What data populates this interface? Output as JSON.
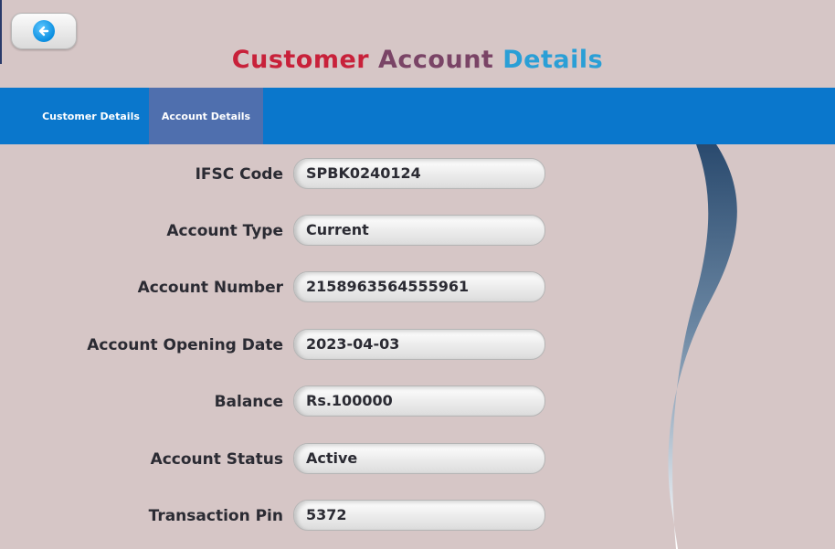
{
  "header": {
    "back_button_icon": "back-arrow-icon",
    "title_word1": "Customer",
    "title_word2": "Account",
    "title_word3": "Details",
    "title_colors": [
      "#c8213a",
      "#7a4466",
      "#2a9fd6"
    ]
  },
  "tabs": [
    {
      "label": "Customer Details",
      "active": false
    },
    {
      "label": "Account Details",
      "active": true
    }
  ],
  "fields": [
    {
      "label": "IFSC Code",
      "value": "SPBK0240124"
    },
    {
      "label": "Account Type",
      "value": "Current"
    },
    {
      "label": "Account Number",
      "value": "2158963564555961"
    },
    {
      "label": "Account Opening Date",
      "value": "2023-04-03"
    },
    {
      "label": "Balance",
      "value": "Rs.100000"
    },
    {
      "label": "Account Status",
      "value": "Active"
    },
    {
      "label": "Transaction Pin",
      "value": "5372"
    }
  ],
  "colors": {
    "tab_bar": "#0a77cc",
    "active_tab": "#4f6fae",
    "background": "#d6c6c6"
  }
}
